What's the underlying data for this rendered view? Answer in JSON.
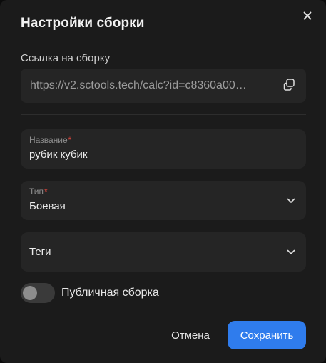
{
  "dialog": {
    "title": "Настройки сборки"
  },
  "link": {
    "label": "Ссылка на сборку",
    "value": "https://v2.sctools.tech/calc?id=c8360a00…"
  },
  "fields": {
    "name": {
      "label": "Название",
      "required_mark": "*",
      "value": "рубик кубик"
    },
    "type": {
      "label": "Тип",
      "required_mark": "*",
      "value": "Боевая"
    },
    "tags": {
      "placeholder": "Теги"
    }
  },
  "public_toggle": {
    "label": "Публичная сборка",
    "enabled": false
  },
  "actions": {
    "cancel_label": "Отмена",
    "save_label": "Сохранить"
  },
  "icons": {
    "close": "close-icon",
    "copy": "copy-icon",
    "dropdown": "chevron-down-icon"
  },
  "colors": {
    "background": "#1b1b1b",
    "field_background": "#252525",
    "accent": "#2f7ced",
    "required": "#e0453d"
  }
}
